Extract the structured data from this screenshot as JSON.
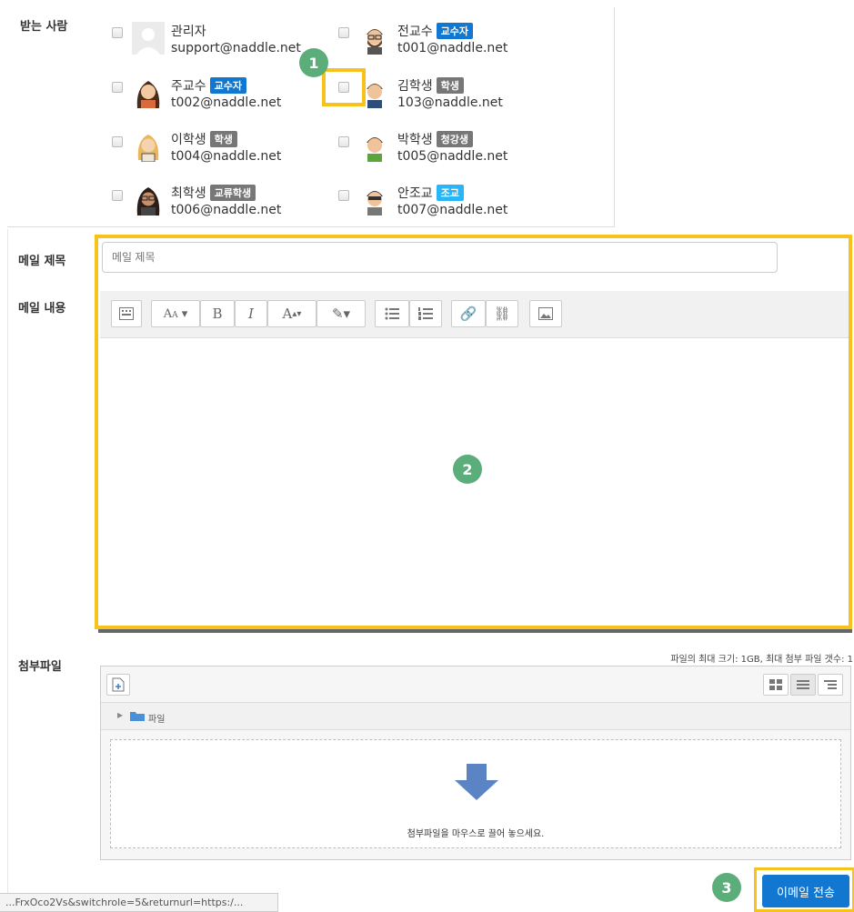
{
  "recipients_label": "받는 사람",
  "recipients": [
    {
      "name": "관리자",
      "email": "support@naddle.net",
      "badge": null,
      "badge_color": null,
      "avatar": "default-avatar-icon",
      "checked": false
    },
    {
      "name": "전교수",
      "email": "t001@naddle.net",
      "badge": "교수자",
      "badge_color": "#1177d1",
      "avatar": "male-glasses-beard-avatar-icon",
      "checked": false
    },
    {
      "name": "주교수",
      "email": "t002@naddle.net",
      "badge": "교수자",
      "badge_color": "#1177d1",
      "avatar": "female-dark-hair-avatar-icon",
      "checked": false
    },
    {
      "name": "김학생",
      "email": "103@naddle.net",
      "badge": "학생",
      "badge_color": "#777777",
      "avatar": "male-student-avatar-icon",
      "checked": false
    },
    {
      "name": "이학생",
      "email": "t004@naddle.net",
      "badge": "학생",
      "badge_color": "#777777",
      "avatar": "female-blonde-avatar-icon",
      "checked": false
    },
    {
      "name": "박학생",
      "email": "t005@naddle.net",
      "badge": "청강생",
      "badge_color": "#777777",
      "avatar": "male-green-shirt-avatar-icon",
      "checked": false
    },
    {
      "name": "최학생",
      "email": "t006@naddle.net",
      "badge": "교류학생",
      "badge_color": "#777777",
      "avatar": "female-glasses-avatar-icon",
      "checked": false
    },
    {
      "name": "안조교",
      "email": "t007@naddle.net",
      "badge": "조교",
      "badge_color": "#29b6f6",
      "avatar": "male-assistant-avatar-icon",
      "checked": false
    }
  ],
  "subject_label": "메일 제목",
  "subject_placeholder": "메일 제목",
  "body_label": "메일 내용",
  "attachments_label": "첨부파일",
  "file_limits": "파일의 최대 크기: 1GB, 최대 첨부 파일 갯수: 1",
  "folder_name": "파일",
  "drop_hint": "첨부파일을 마우스로 끌어 놓으세요.",
  "send_label": "이메일 전송",
  "status_url": "...FrxOco2Vs&switchrole=5&returnurl=https:/...",
  "callouts": [
    "1",
    "2",
    "3"
  ],
  "colors": {
    "highlight": "#f7c21c",
    "callout": "#5bad7a",
    "primary": "#1177d1"
  }
}
